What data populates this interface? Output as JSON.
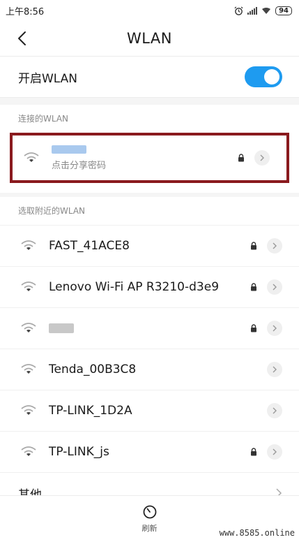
{
  "status": {
    "time": "上午8:56",
    "battery": "94"
  },
  "header": {
    "title": "WLAN"
  },
  "toggle": {
    "label": "开启WLAN",
    "on": true
  },
  "connected": {
    "section_title": "连接的WLAN",
    "network": {
      "name": "",
      "subtitle": "点击分享密码",
      "locked": true
    }
  },
  "nearby": {
    "section_title": "选取附近的WLAN",
    "networks": [
      {
        "name": "FAST_41ACE8",
        "locked": true
      },
      {
        "name": "Lenovo Wi-Fi AP R3210-d3e9",
        "locked": true
      },
      {
        "name": "",
        "locked": true
      },
      {
        "name": "Tenda_00B3C8",
        "locked": false
      },
      {
        "name": "TP-LINK_1D2A",
        "locked": false
      },
      {
        "name": "TP-LINK_js",
        "locked": true
      }
    ]
  },
  "other": {
    "label": "其他..."
  },
  "bottom": {
    "refresh_label": "刷新"
  },
  "watermark": "www.8585.online",
  "colors": {
    "accent": "#1e9bf0",
    "highlight_border": "#8a1a1e"
  }
}
